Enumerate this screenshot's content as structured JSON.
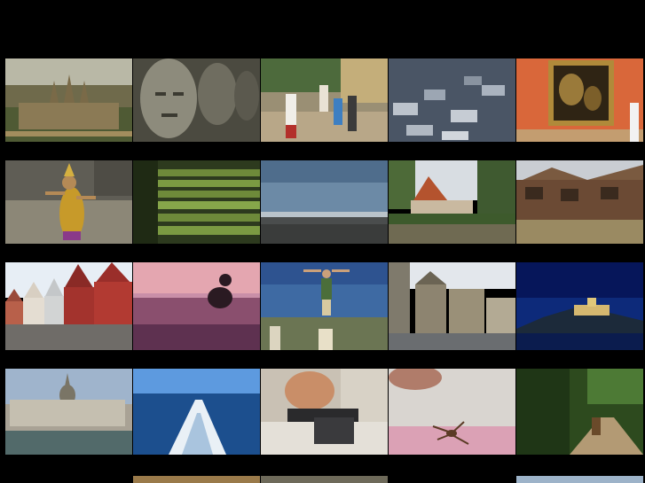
{
  "gallery": {
    "thumbnails": [
      {
        "id": 1,
        "subject": "temple-aerial"
      },
      {
        "id": 2,
        "subject": "stone-faces"
      },
      {
        "id": 3,
        "subject": "balcony-people"
      },
      {
        "id": 4,
        "subject": "city-rooftops"
      },
      {
        "id": 5,
        "subject": "museum-painting"
      },
      {
        "id": 6,
        "subject": "dancer"
      },
      {
        "id": 7,
        "subject": "mossy-stairs"
      },
      {
        "id": 8,
        "subject": "rocky-shore"
      },
      {
        "id": 9,
        "subject": "riverside-temple"
      },
      {
        "id": 10,
        "subject": "stilt-houses"
      },
      {
        "id": 11,
        "subject": "gabled-houses"
      },
      {
        "id": 12,
        "subject": "surfer-sunset"
      },
      {
        "id": 13,
        "subject": "man-on-post"
      },
      {
        "id": 14,
        "subject": "town-square"
      },
      {
        "id": 15,
        "subject": "castle-night"
      },
      {
        "id": 16,
        "subject": "parliament-river"
      },
      {
        "id": 17,
        "subject": "boat-wake"
      },
      {
        "id": 18,
        "subject": "man-lying"
      },
      {
        "id": 19,
        "subject": "spider-on-bed"
      },
      {
        "id": 20,
        "subject": "jungle-path"
      }
    ]
  }
}
